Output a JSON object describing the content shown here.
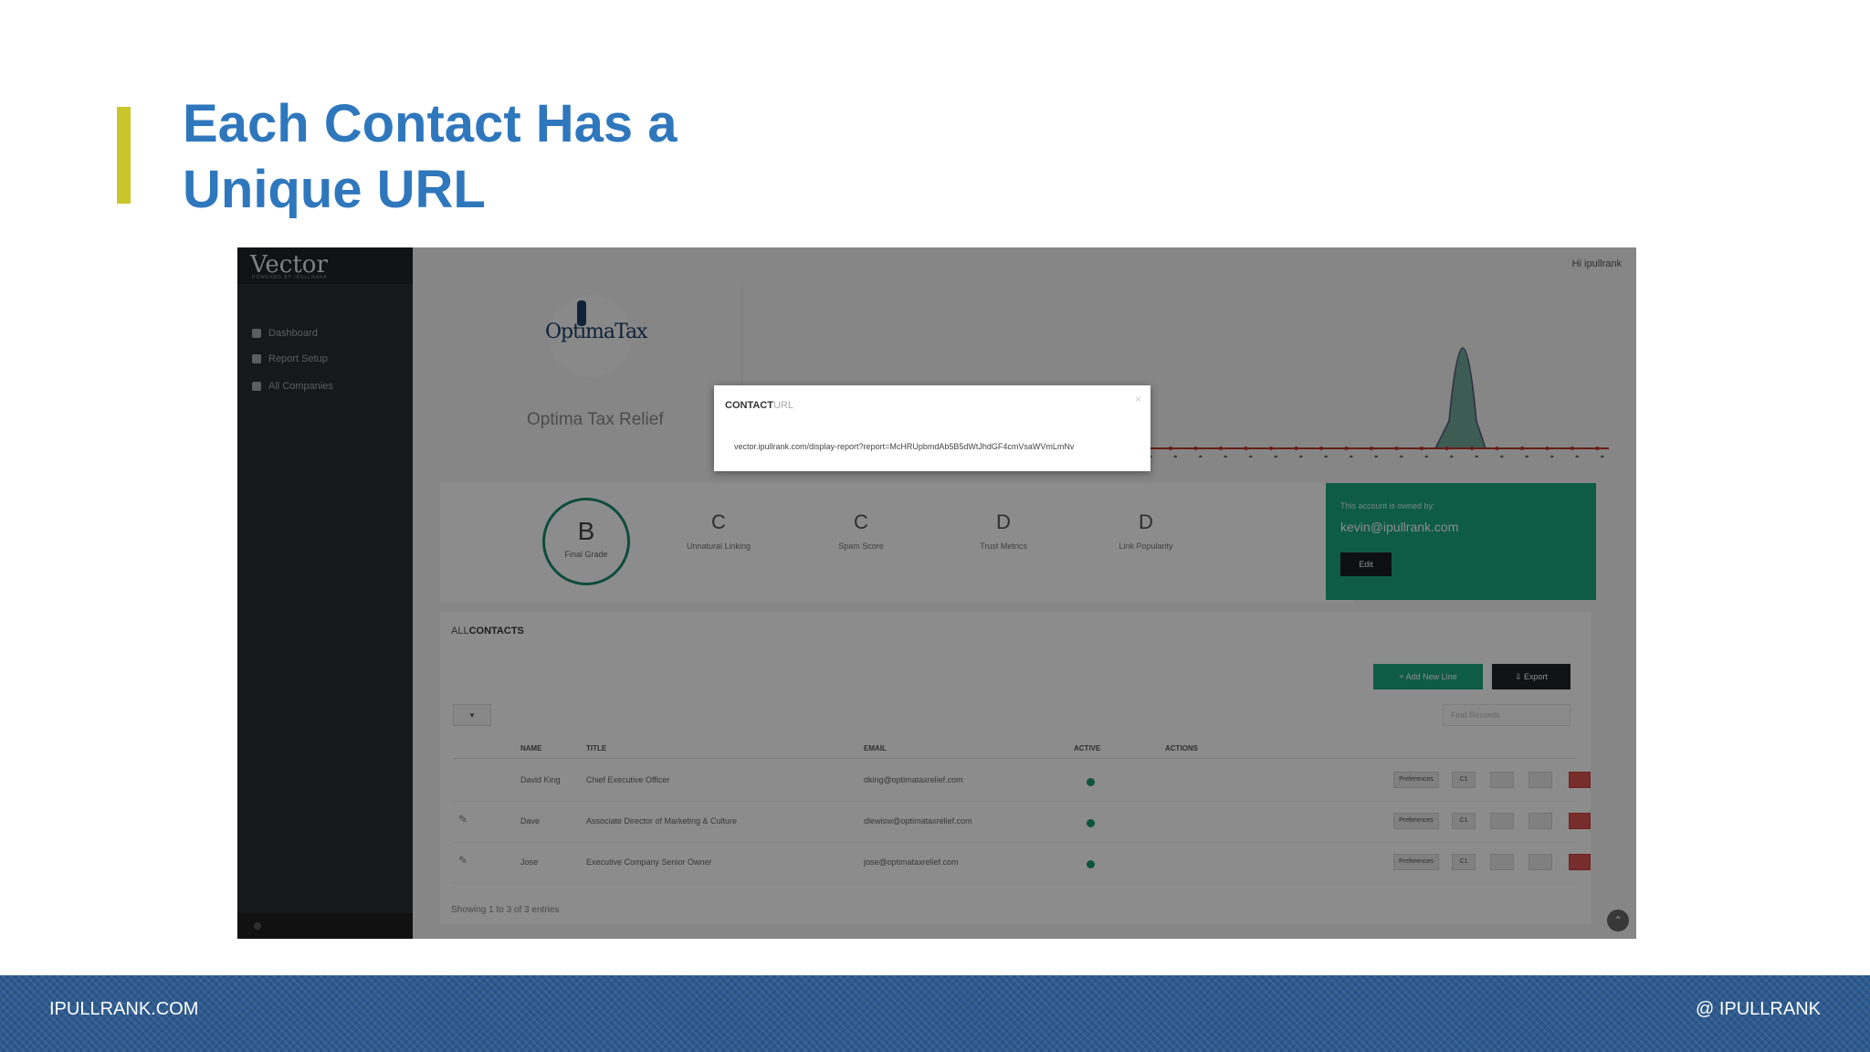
{
  "title": {
    "line1": "Each Contact Has a",
    "line2": "Unique URL"
  },
  "footer": {
    "left": "IPULLRANK.COM",
    "right": "@ IPULLRANK"
  },
  "app": {
    "logo": "Vector",
    "logo_sub": "POWERED BY IPULLRANK",
    "sidebar_items": [
      "Dashboard",
      "Report Setup",
      "All Companies"
    ],
    "top_right": "Hi ipullrank",
    "company_logo_text": "OptimaTax",
    "company_name": "Optima Tax Relief",
    "grades": {
      "final": {
        "grade": "B",
        "label": "Final Grade"
      },
      "items": [
        {
          "grade": "C",
          "label": "Unnatural Linking"
        },
        {
          "grade": "C",
          "label": "Spam Score"
        },
        {
          "grade": "D",
          "label": "Trust Metrics"
        },
        {
          "grade": "D",
          "label": "Link Popularity"
        }
      ]
    },
    "owner": {
      "label": "This account is owned by:",
      "email": "kevin@ipullrank.com",
      "button": "Edit"
    },
    "contacts": {
      "header_prefix": "ALL",
      "header": "CONTACTS",
      "add_button": "+ Add New Line",
      "export_button": "⇩ Export",
      "per_page": "▾",
      "search_placeholder": "Find Records",
      "columns": [
        "NAME",
        "TITLE",
        "EMAIL",
        "ACTIVE",
        "ACTIONS"
      ],
      "rows": [
        {
          "name": "David King",
          "title": "Chief Executive Officer",
          "email": "dking@optimataxrelief.com",
          "action": "Preferences",
          "btn1": "C1"
        },
        {
          "name": "Dave",
          "title": "Associate Director of Marketing & Culture",
          "email": "dlewisw@optimataxrelief.com",
          "action": "Preferences",
          "btn1": "C1"
        },
        {
          "name": "Jose",
          "title": "Executive Company Senior Owner",
          "email": "jose@optimataxrelief.com",
          "action": "Preferences",
          "btn1": "C1"
        }
      ],
      "showing": "Showing 1 to 3 of 3 entries"
    },
    "modal": {
      "title": "CONTACT",
      "title_suffix": "URL",
      "close": "×",
      "url": "vector.ipullrank.com/display-report?report=McHRUpbmdAb5B5dWtJhdGF4cmVsaWVmLmNv"
    },
    "colors": {
      "accent_green": "#1aa780",
      "title_blue": "#2f77bd",
      "title_bar": "#c9c62b"
    }
  }
}
